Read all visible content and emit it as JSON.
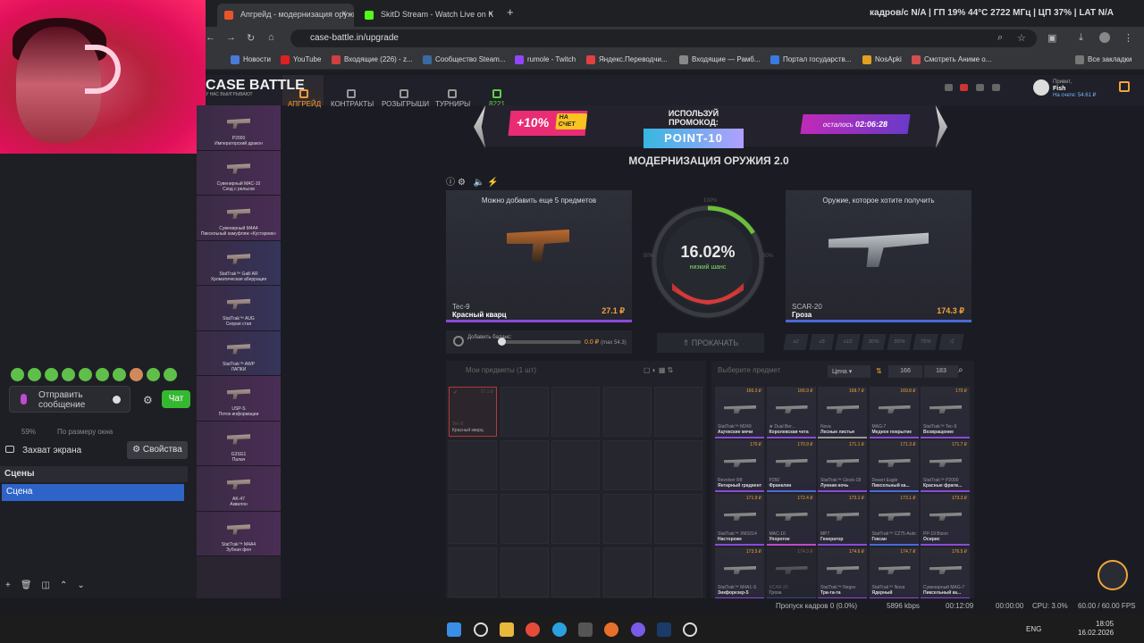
{
  "browser": {
    "tabs": [
      {
        "title": "Апгрейд - модернизация оружи",
        "icon_color": "#e8552a"
      },
      {
        "title": "SkitD Stream - Watch Live on K",
        "icon_color": "#53fc18"
      }
    ],
    "new_tab": "+",
    "url": "case-battle.in/upgrade",
    "stats": "кадров/с N/A  |  ГП 19% 44°C 2722 МГц  |  ЦП 37%  |  LAT N/A",
    "bookmarks": [
      "Новости",
      "YouTube",
      "Входящие (226) - z...",
      "Сообщество Steam...",
      "rumole - Twitch",
      "Яндекс.Переводчи...",
      "Входящие — Рамб...",
      "Портал государств...",
      "NosApki",
      "Смотреть Аниме о..."
    ],
    "all_bookmarks": "Все закладки"
  },
  "obs": {
    "send_message": "Отправить сообщение",
    "chat_button": "Чат",
    "zoom": "59%",
    "fit": "По размеру окна",
    "capture": "Захват экрана",
    "properties": "Свойства",
    "scenes_header": "Сцены",
    "scene_selected": "Сцена"
  },
  "site": {
    "logo": "CASE BATTLE",
    "logo_sub": "У НАС ВЫИГРЫВАЮТ",
    "nav": [
      "АПГРЕЙД",
      "КОНТРАКТЫ",
      "РОЗЫГРЫШИ",
      "ТУРНИРЫ"
    ],
    "online": "8221",
    "user_greeting": "Привет,",
    "user_name": "Fish",
    "user_balance": "На счете: 54.61 ₽",
    "promo_bonus": "+10%",
    "promo_bonus_sub": "НА СЧЕТ",
    "promo_label": "ИСПОЛЬЗУЙ ПРОМОКОД:",
    "promo_code": "POINT-10",
    "promo_timer_label": "осталось",
    "promo_timer": "02:06:28",
    "title": "МОДЕРНИЗАЦИЯ ОРУЖИЯ 2.0",
    "left_card": {
      "title": "Можно добавить еще 5 предметов",
      "weapon": "Tec-9",
      "skin": "Красный кварц",
      "price": "27.1 ₽"
    },
    "right_card": {
      "title": "Оружие, которое хотите получить",
      "weapon": "SCAR-20",
      "skin": "Гроза",
      "price": "174.3 ₽"
    },
    "chance": "16.02%",
    "chance_label": "низкий шанс",
    "chance_value": 0.1602,
    "dial_top": "100%",
    "dial_left": "50%",
    "dial_right": "50%",
    "balance_label": "Добавить баланс:",
    "balance_value": "0.0 ₽",
    "balance_max": "(max 54.3)",
    "spin": "ПРОКАЧАТЬ",
    "multipliers": [
      "x2",
      "x5",
      "x10",
      "30%",
      "50%",
      "75%"
    ],
    "my_items": "Мои предметы (1 шт)",
    "my_item": {
      "price": "27.1 ₽",
      "name": "Tec-9",
      "skin": "Красный кварц"
    },
    "choose_item": "Выберите предмет",
    "sort": "Цена",
    "price_from": "166",
    "price_to": "183"
  },
  "strip": [
    {
      "name": "P2000",
      "skin": "Императорский дракон",
      "color": "#4a2d55"
    },
    {
      "name": "Сувенирный MAC-10",
      "skin": "Сход с рельсов",
      "color": "#4a2d55"
    },
    {
      "name": "Сувенирный M4A4",
      "skin": "Пиксельный камуфляж «Кустарник»",
      "color": "#4a2d55"
    },
    {
      "name": "StatTrak™ Galil AR",
      "skin": "Хроматическая аберрация",
      "color": "#35345a"
    },
    {
      "name": "StatTrak™ AUG",
      "skin": "Скорая стая",
      "color": "#35345a"
    },
    {
      "name": "StatTrak™ AWP",
      "skin": "ЛАПКИ",
      "color": "#35345a"
    },
    {
      "name": "USP-S",
      "skin": "Поток информации",
      "color": "#4a2d55"
    },
    {
      "name": "G3SG1",
      "skin": "Палач",
      "color": "#4a2d55"
    },
    {
      "name": "AK-47",
      "skin": "Аквилон",
      "color": "#4a2d55"
    },
    {
      "name": "StatTrak™ M4A4",
      "skin": "Зубная фея",
      "color": "#4a2d55"
    }
  ],
  "market": [
    {
      "price": "166.3 ₽",
      "n1": "StatTrak™ M249",
      "n2": "Ацтекские мечи",
      "c": "#8a4ad8"
    },
    {
      "price": "166.9 ₽",
      "n1": "★ Dual Ber...",
      "n2": "Королевская чета",
      "c": "#8a4ad8"
    },
    {
      "price": "168.7 ₽",
      "n1": "Nova",
      "n2": "Лесные листья",
      "c": "#999999"
    },
    {
      "price": "169.8 ₽",
      "n1": "MAG-7",
      "n2": "Медное покрытие",
      "c": "#8a4ad8"
    },
    {
      "price": "170 ₽",
      "n1": "StatTrak™ Tec-9",
      "n2": "Возвращение",
      "c": "#8a4ad8"
    },
    {
      "price": "170 ₽",
      "n1": "Revolver R8",
      "n2": "Янтарный градиент",
      "c": "#8a4ad8"
    },
    {
      "price": "170.9 ₽",
      "n1": "P250",
      "n2": "Франклин",
      "c": "#4a6ad8"
    },
    {
      "price": "171.1 ₽",
      "n1": "StatTrak™ Glock-18",
      "n2": "Лунная ночь",
      "c": "#8a4ad8"
    },
    {
      "price": "171.3 ₽",
      "n1": "Desert Eagle",
      "n2": "Пиксельный ка...",
      "c": "#4a6ad8"
    },
    {
      "price": "171.7 ₽",
      "n1": "StatTrak™ P2000",
      "n2": "Красные фрагм...",
      "c": "#8a4ad8"
    },
    {
      "price": "171.9 ₽",
      "n1": "StatTrak™ XM1014",
      "n2": "Настороже",
      "c": "#8a4ad8"
    },
    {
      "price": "172.4 ₽",
      "n1": "MAC-10",
      "n2": "Упоротое",
      "c": "#c04ac8"
    },
    {
      "price": "173.1 ₽",
      "n1": "MP7",
      "n2": "Генератор",
      "c": "#8a4ad8"
    },
    {
      "price": "173.1 ₽",
      "n1": "StatTrak™ CZ75-Auto",
      "n2": "Гексан",
      "c": "#4a6ad8"
    },
    {
      "price": "173.3 ₽",
      "n1": "PP-19 Bizon",
      "n2": "Осирис",
      "c": "#8a4ad8"
    },
    {
      "price": "173.5 ₽",
      "n1": "StatTrak™ M4A1-S",
      "n2": "Зикфорезер-5",
      "c": "#8a4ad8"
    },
    {
      "price": "174.3 ₽",
      "n1": "SCAR-20",
      "n2": "Гроза",
      "c": "#4a6ad8"
    },
    {
      "price": "174.6 ₽",
      "n1": "StatTrak™ Negev",
      "n2": "Тра-та-та",
      "c": "#8a4ad8"
    },
    {
      "price": "174.7 ₽",
      "n1": "StatTrak™ Nova",
      "n2": "Ядерный",
      "c": "#8a4ad8"
    },
    {
      "price": "176.5 ₽",
      "n1": "Сувенирный MAG-7",
      "n2": "Пиксельный ка...",
      "c": "#8a4ad8"
    }
  ],
  "status_bar": {
    "skipped": "Пропуск кадров 0 (0.0%)",
    "bitrate": "5896 kbps",
    "rec": "00:12:09",
    "stream": "00:00:00",
    "cpu": "CPU: 3.0%",
    "fps": "60.00 / 60.00 FPS"
  },
  "taskbar": {
    "lang": "ENG",
    "time": "18:05",
    "date": "16.02.2026"
  }
}
